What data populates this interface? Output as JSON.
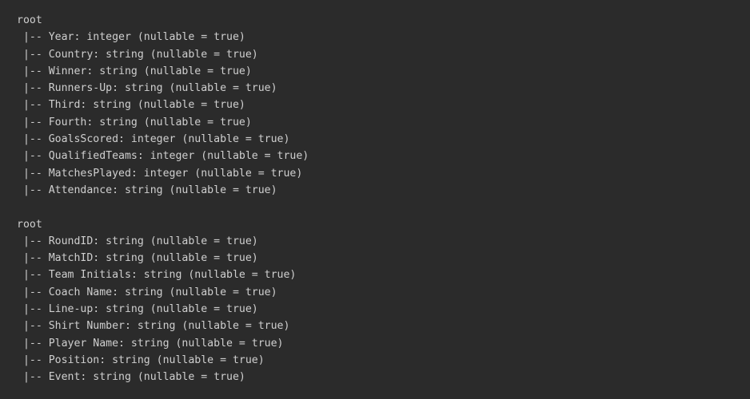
{
  "output": {
    "blocks": [
      {
        "header": "root",
        "lines": [
          " |-- Year: integer (nullable = true)",
          " |-- Country: string (nullable = true)",
          " |-- Winner: string (nullable = true)",
          " |-- Runners-Up: string (nullable = true)",
          " |-- Third: string (nullable = true)",
          " |-- Fourth: string (nullable = true)",
          " |-- GoalsScored: integer (nullable = true)",
          " |-- QualifiedTeams: integer (nullable = true)",
          " |-- MatchesPlayed: integer (nullable = true)",
          " |-- Attendance: string (nullable = true)"
        ]
      },
      {
        "header": "root",
        "lines": [
          " |-- RoundID: string (nullable = true)",
          " |-- MatchID: string (nullable = true)",
          " |-- Team Initials: string (nullable = true)",
          " |-- Coach Name: string (nullable = true)",
          " |-- Line-up: string (nullable = true)",
          " |-- Shirt Number: string (nullable = true)",
          " |-- Player Name: string (nullable = true)",
          " |-- Position: string (nullable = true)",
          " |-- Event: string (nullable = true)"
        ]
      }
    ]
  }
}
